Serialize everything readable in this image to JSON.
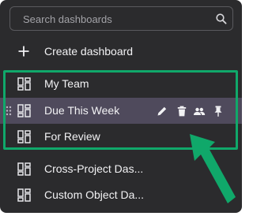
{
  "search": {
    "placeholder": "Search dashboards",
    "icon": "search-icon"
  },
  "create": {
    "label": "Create dashboard",
    "icon": "plus-icon"
  },
  "highlighted_items": [
    {
      "label": "My Team",
      "icon": "dashboard-icon"
    },
    {
      "label": "Due This Week",
      "icon": "dashboard-icon",
      "hovered": true
    },
    {
      "label": "For Review",
      "icon": "dashboard-icon"
    }
  ],
  "hover_actions": [
    "edit-icon",
    "delete-icon",
    "share-icon",
    "pin-icon"
  ],
  "other_items": [
    {
      "label": "Cross-Project Das...",
      "icon": "dashboard-icon"
    },
    {
      "label": "Custom Object Da...",
      "icon": "dashboard-icon"
    }
  ],
  "colors": {
    "menu_background": "#2b2b2d",
    "hover_row": "#4f4a5c",
    "annotation_green": "#10a86a",
    "text": "#f2f2f4",
    "placeholder": "#a3a3a8"
  }
}
